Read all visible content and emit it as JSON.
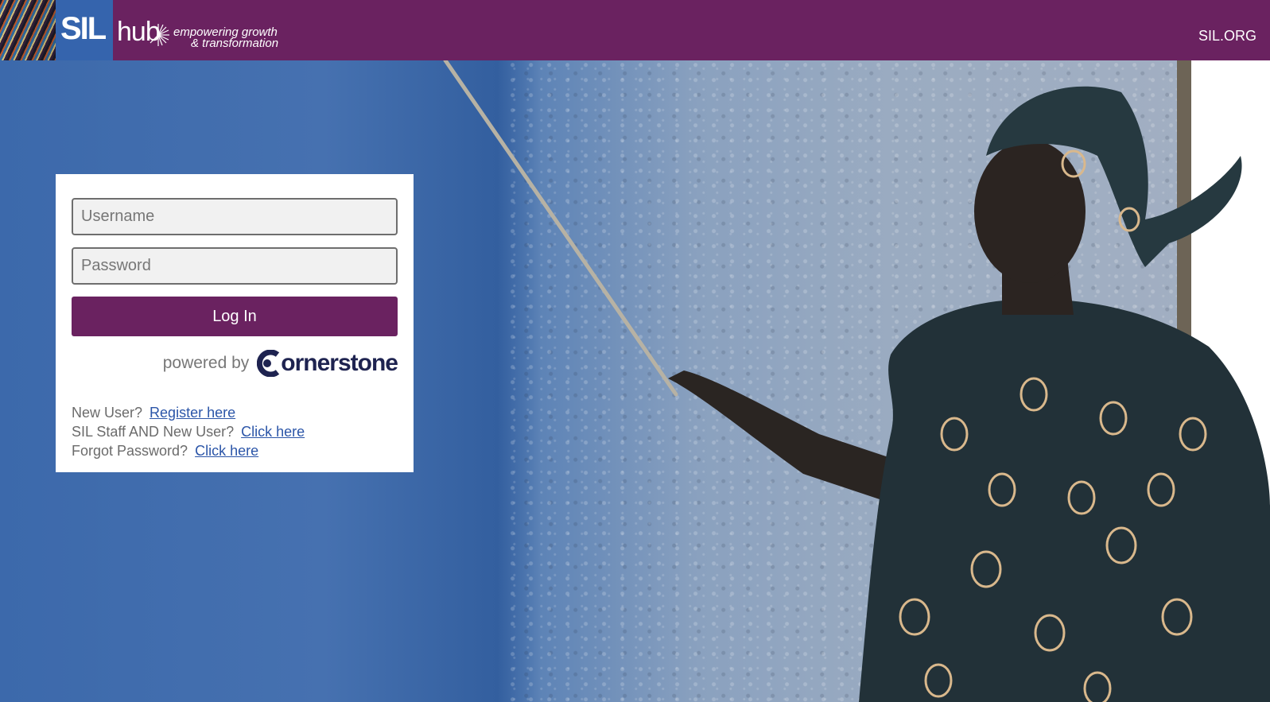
{
  "header": {
    "logo_sil": "SIL",
    "logo_hub": "hub",
    "tagline_line1": "empowering growth",
    "tagline_line2": "& transformation",
    "site_link": "SIL.ORG",
    "background_color": "#6a2260"
  },
  "login": {
    "username_placeholder": "Username",
    "password_placeholder": "Password",
    "login_button": "Log In",
    "button_color": "#6a2260",
    "powered_by": "powered by",
    "powered_brand": "ornerstone"
  },
  "links": [
    {
      "prompt": "New User?",
      "link_text": "Register here"
    },
    {
      "prompt": "SIL Staff AND New User?",
      "link_text": "Click here"
    },
    {
      "prompt": "Forgot Password?",
      "link_text": "Click here"
    }
  ],
  "icons": {
    "logo_sun": "sunburst-icon",
    "cornerstone_mark": "cornerstone-c-icon"
  }
}
